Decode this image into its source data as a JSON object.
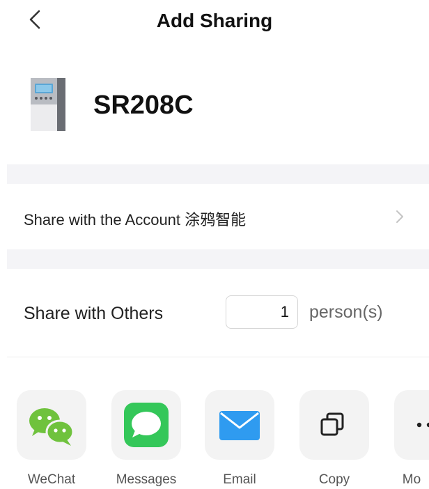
{
  "header": {
    "back_icon": "chevron-left-icon",
    "title": "Add Sharing"
  },
  "device": {
    "image_icon": "device-controller-icon",
    "name": "SR208C"
  },
  "share_account": {
    "label": "Share with the Account 涂鸦智能",
    "chevron_icon": "chevron-right-icon"
  },
  "share_others": {
    "label": "Share with Others",
    "count": "1",
    "unit": "person(s)"
  },
  "share_targets": [
    {
      "label": "WeChat",
      "icon": "wechat-icon",
      "color": "#6FC23D"
    },
    {
      "label": "Messages",
      "icon": "messages-icon",
      "color": "#34C759"
    },
    {
      "label": "Email",
      "icon": "email-icon",
      "color": "#2F9BF0"
    },
    {
      "label": "Copy",
      "icon": "copy-icon",
      "color": "#222222"
    },
    {
      "label": "Mo",
      "icon": "more-icon",
      "color": "#222222"
    }
  ]
}
